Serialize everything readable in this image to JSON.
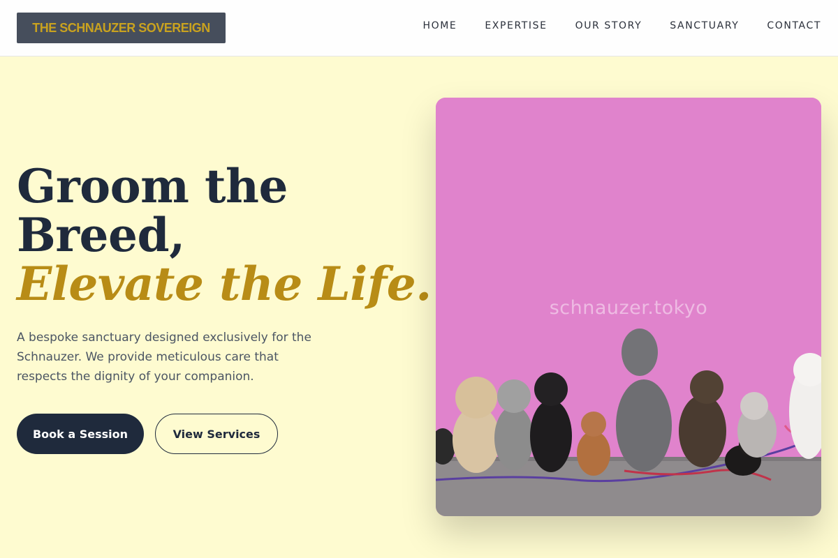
{
  "brand": {
    "logo_text": "THE SCHNAUZER SOVEREIGN"
  },
  "nav": {
    "items": [
      {
        "label": "HOME"
      },
      {
        "label": "EXPERTISE"
      },
      {
        "label": "OUR STORY"
      },
      {
        "label": "SANCTUARY"
      },
      {
        "label": "CONTACT"
      }
    ]
  },
  "hero": {
    "headline_line1": "Groom the",
    "headline_line2": "Breed,",
    "headline_accent": "Elevate the Life.",
    "description": "A bespoke sanctuary designed exclusively for the Schnauzer. We provide meticulous care that respects the dignity of your companion.",
    "primary_button": "Book a Session",
    "secondary_button": "View Services",
    "image_watermark": "schnauzer.tokyo"
  },
  "colors": {
    "page_background": "#fefbd0",
    "navy": "#1f2a3c",
    "gold_accent": "#b88c16",
    "logo_background": "#464e5c",
    "photo_wall": "#de7fc9"
  }
}
